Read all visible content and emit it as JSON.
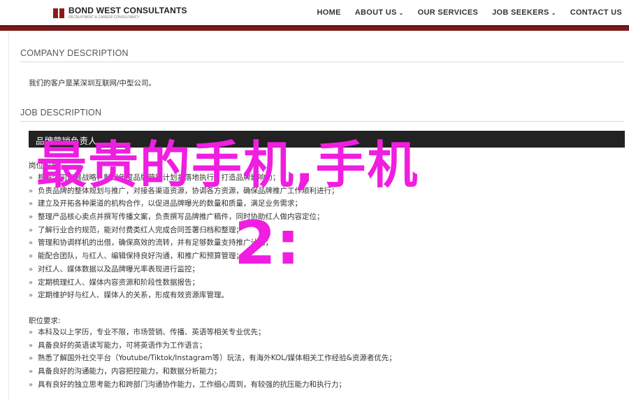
{
  "header": {
    "logo_name": "BOND WEST CONSULTANTS",
    "logo_tagline": "RECRUITMENT & CAREER CONSULTANCY",
    "nav": [
      {
        "label": "HOME",
        "has_caret": false
      },
      {
        "label": "ABOUT US",
        "has_caret": true
      },
      {
        "label": "OUR SERVICES",
        "has_caret": false
      },
      {
        "label": "JOB SEEKERS",
        "has_caret": true
      },
      {
        "label": "CONTACT US",
        "has_caret": false
      }
    ],
    "caret": "⌄",
    "brand_color": "#7a1a1a"
  },
  "company": {
    "title": "COMPANY DESCRIPTION",
    "text": "我们的客户是某深圳互联网/中型公司。"
  },
  "job": {
    "title": "JOB DESCRIPTION",
    "position_bar": "品牌营销负责人",
    "duties_heading": "岗位职责",
    "duties": [
      "根据公司发展战略，制定年度品牌营销计划并落地执行，打造品牌影响力；",
      "负责品牌的整体规划与推广，对接各渠道资源，协调各方资源，确保品牌推广工作顺利进行；",
      "建立及开拓各种渠道的机构合作，以促进品牌曝光的数量和质量，满足业务需求；",
      "整理产品核心卖点并撰写传播文案，负责撰写品牌推广稿件，同时协助红人做内容定位；",
      "了解行业合约规范，能对付费类红人完成合同签署归档和整理；",
      "管理和协调样机的出借，确保高效的流转，并有足够数量支持推广计划；",
      "能配合团队，与红人、编辑保持良好沟通，和推广和预算管理；",
      "对红人、媒体数据以及品牌曝光率表现进行监控；",
      "定期梳理红人、媒体内容资源和阶段性数据报告；",
      "定期维护好与红人、媒体人的关系，形成有效资源库管理。"
    ],
    "req_heading": "职位要求:",
    "requirements": [
      "本科及以上学历，专业不限，市场营销、传播、英语等相关专业优先；",
      "具备良好的英语读写能力，可将英语作为工作语言；",
      "熟悉了解国外社交平台（Youtube/Tiktok/Instagram等）玩法，有海外KOL/媒体相关工作经验&资源者优先；",
      "具备良好的沟通能力，内容把控能力，和数据分析能力；",
      "具有良好的独立思考能力和跨部门沟通协作能力，工作细心周到，有较强的抗压能力和执行力；"
    ],
    "bullet": "»"
  },
  "overlay": {
    "line1": "最贵的手机,手机",
    "line2": "2:",
    "color": "#f01ee0"
  }
}
